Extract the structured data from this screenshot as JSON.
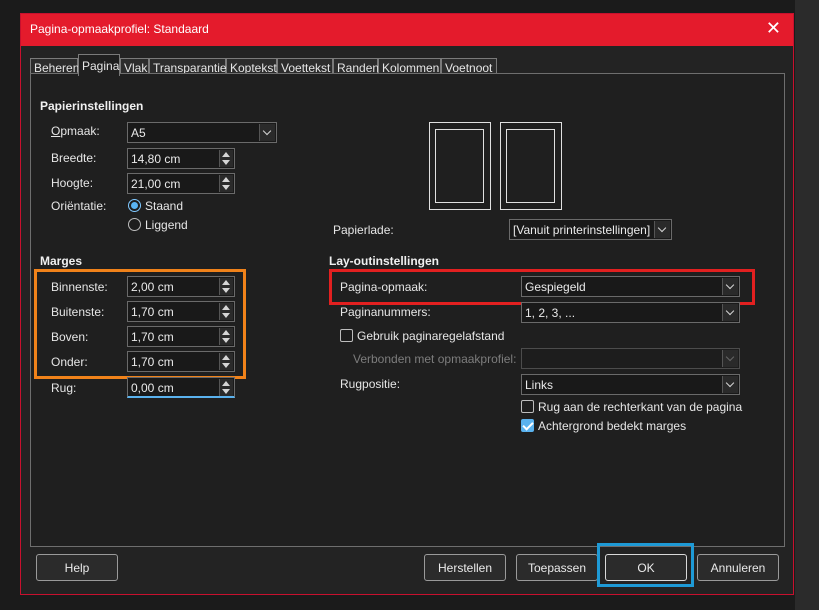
{
  "window": {
    "title": "Pagina-opmaakprofiel: Standaard",
    "close": "✕"
  },
  "tabs": [
    "Beheren",
    "Pagina",
    "Vlak",
    "Transparantie",
    "Koptekst",
    "Voettekst",
    "Randen",
    "Kolommen",
    "Voetnoot"
  ],
  "active_tab": "Pagina",
  "paper": {
    "section_title": "Papierinstellingen",
    "format_label": "Opmaak:",
    "format_value": "A5",
    "width_label": "Breedte:",
    "width_value": "14,80 cm",
    "height_label": "Hoogte:",
    "height_value": "21,00 cm",
    "orientation_label": "Oriëntatie:",
    "portrait_label": "Staand",
    "landscape_label": "Liggend",
    "orientation_selected": "Staand",
    "tray_label": "Papierlade:",
    "tray_value": "[Vanuit printerinstellingen]"
  },
  "margins": {
    "section_title": "Marges",
    "inner_label": "Binnenste:",
    "inner_value": "2,00 cm",
    "outer_label": "Buitenste:",
    "outer_value": "1,70 cm",
    "top_label": "Boven:",
    "top_value": "1,70 cm",
    "bottom_label": "Onder:",
    "bottom_value": "1,70 cm",
    "gutter_label": "Rug:",
    "gutter_value": "0,00 cm"
  },
  "layout": {
    "section_title": "Lay-outinstellingen",
    "page_layout_label": "Pagina-opmaak:",
    "page_layout_value": "Gespiegeld",
    "page_numbers_label": "Paginanummers:",
    "page_numbers_value": "1, 2, 3, ...",
    "register_label": "Gebruik paginaregelafstand",
    "register_checked": false,
    "reference_style_label": "Verbonden met opmaakprofiel:",
    "reference_style_value": "",
    "gutter_position_label": "Rugpositie:",
    "gutter_position_value": "Links",
    "gutter_right_label": "Rug aan de rechterkant van de pagina",
    "gutter_right_checked": false,
    "background_label": "Achtergrond bedekt marges",
    "background_checked": true
  },
  "buttons": {
    "help": "Help",
    "reset": "Herstellen",
    "apply": "Toepassen",
    "ok": "OK",
    "cancel": "Annuleren"
  },
  "colors": {
    "titlebar": "#e41b2c",
    "highlight_margins": "#f0821a",
    "highlight_layout": "#e22020",
    "highlight_ok": "#1e9ad6",
    "accent": "#5ab2ee"
  }
}
